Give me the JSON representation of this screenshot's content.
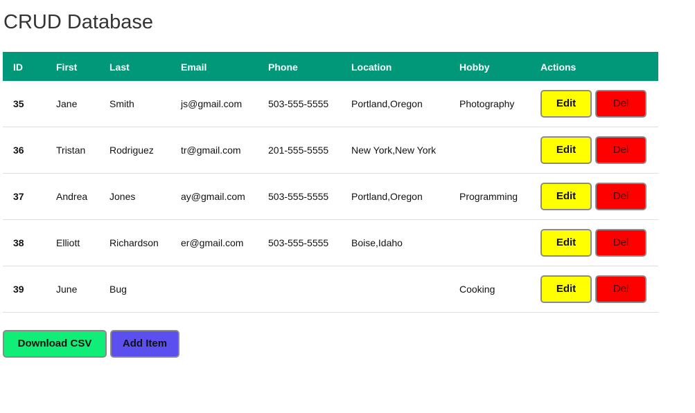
{
  "page": {
    "title": "CRUD Database"
  },
  "table": {
    "headers": {
      "id": "ID",
      "first": "First",
      "last": "Last",
      "email": "Email",
      "phone": "Phone",
      "location": "Location",
      "hobby": "Hobby",
      "actions": "Actions"
    },
    "rows": [
      {
        "id": "35",
        "first": "Jane",
        "last": "Smith",
        "email": "js@gmail.com",
        "phone": "503-555-5555",
        "location": "Portland,Oregon",
        "hobby": "Photography"
      },
      {
        "id": "36",
        "first": "Tristan",
        "last": "Rodriguez",
        "email": "tr@gmail.com",
        "phone": "201-555-5555",
        "location": "New York,New York",
        "hobby": ""
      },
      {
        "id": "37",
        "first": "Andrea",
        "last": "Jones",
        "email": "ay@gmail.com",
        "phone": "503-555-5555",
        "location": "Portland,Oregon",
        "hobby": "Programming"
      },
      {
        "id": "38",
        "first": "Elliott",
        "last": "Richardson",
        "email": "er@gmail.com",
        "phone": "503-555-5555",
        "location": "Boise,Idaho",
        "hobby": ""
      },
      {
        "id": "39",
        "first": "June",
        "last": "Bug",
        "email": "",
        "phone": "",
        "location": "",
        "hobby": "Cooking"
      }
    ],
    "edit_label": "Edit",
    "delete_label": "Del"
  },
  "footer": {
    "download_label": "Download CSV",
    "add_label": "Add Item"
  },
  "colors": {
    "header_bg": "#009879",
    "edit_button": "#ffff00",
    "delete_button": "#ff0000",
    "download_button": "#11ee77",
    "add_button": "#5b4ff0"
  }
}
